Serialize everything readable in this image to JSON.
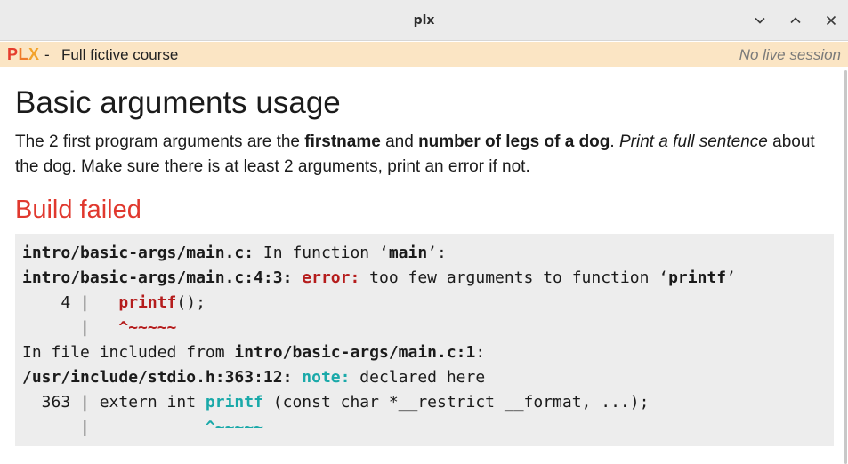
{
  "window": {
    "title": "plx",
    "controls": [
      "chevron-down-icon",
      "chevron-up-icon",
      "close-icon"
    ]
  },
  "topbar": {
    "logo": {
      "p": "P",
      "l": "L",
      "x": "X"
    },
    "separator": "-",
    "course": "Full fictive course",
    "session_status": "No live session"
  },
  "exercise": {
    "title": "Basic arguments usage",
    "desc_1": "The 2 first program arguments are the ",
    "desc_b1": "firstname",
    "desc_2": " and ",
    "desc_b2": "number of legs of a dog",
    "desc_3": ". ",
    "desc_i1": "Print a full sentence",
    "desc_4": " about the dog. Make sure there is at least 2 arguments, print an error if not."
  },
  "build": {
    "status": "Build failed",
    "line1_loc": "intro/basic-args/main.c:",
    "line1_msg": " In function ‘",
    "line1_fn": "main",
    "line1_end": "’:",
    "line2_loc": "intro/basic-args/main.c:4:3:",
    "line2_sp": " ",
    "line2_kind": "error:",
    "line2_msg": " too few arguments to function ‘",
    "line2_fn": "printf",
    "line2_end": "’",
    "line3_gutter": "    4 |   ",
    "line3_code": "printf",
    "line3_rest": "();",
    "line4_gutter": "      |   ",
    "line4_caret": "^~~~~~",
    "line5_msg": "In file included from ",
    "line5_loc": "intro/basic-args/main.c:1",
    "line5_end": ":",
    "line6_loc": "/usr/include/stdio.h:363:12:",
    "line6_sp": " ",
    "line6_kind": "note:",
    "line6_msg": " declared here",
    "line7_gutter": "  363 | extern int ",
    "line7_fn": "printf",
    "line7_rest": " (const char *__restrict __format, ...);",
    "line8_gutter": "      |            ",
    "line8_caret": "^~~~~~"
  }
}
